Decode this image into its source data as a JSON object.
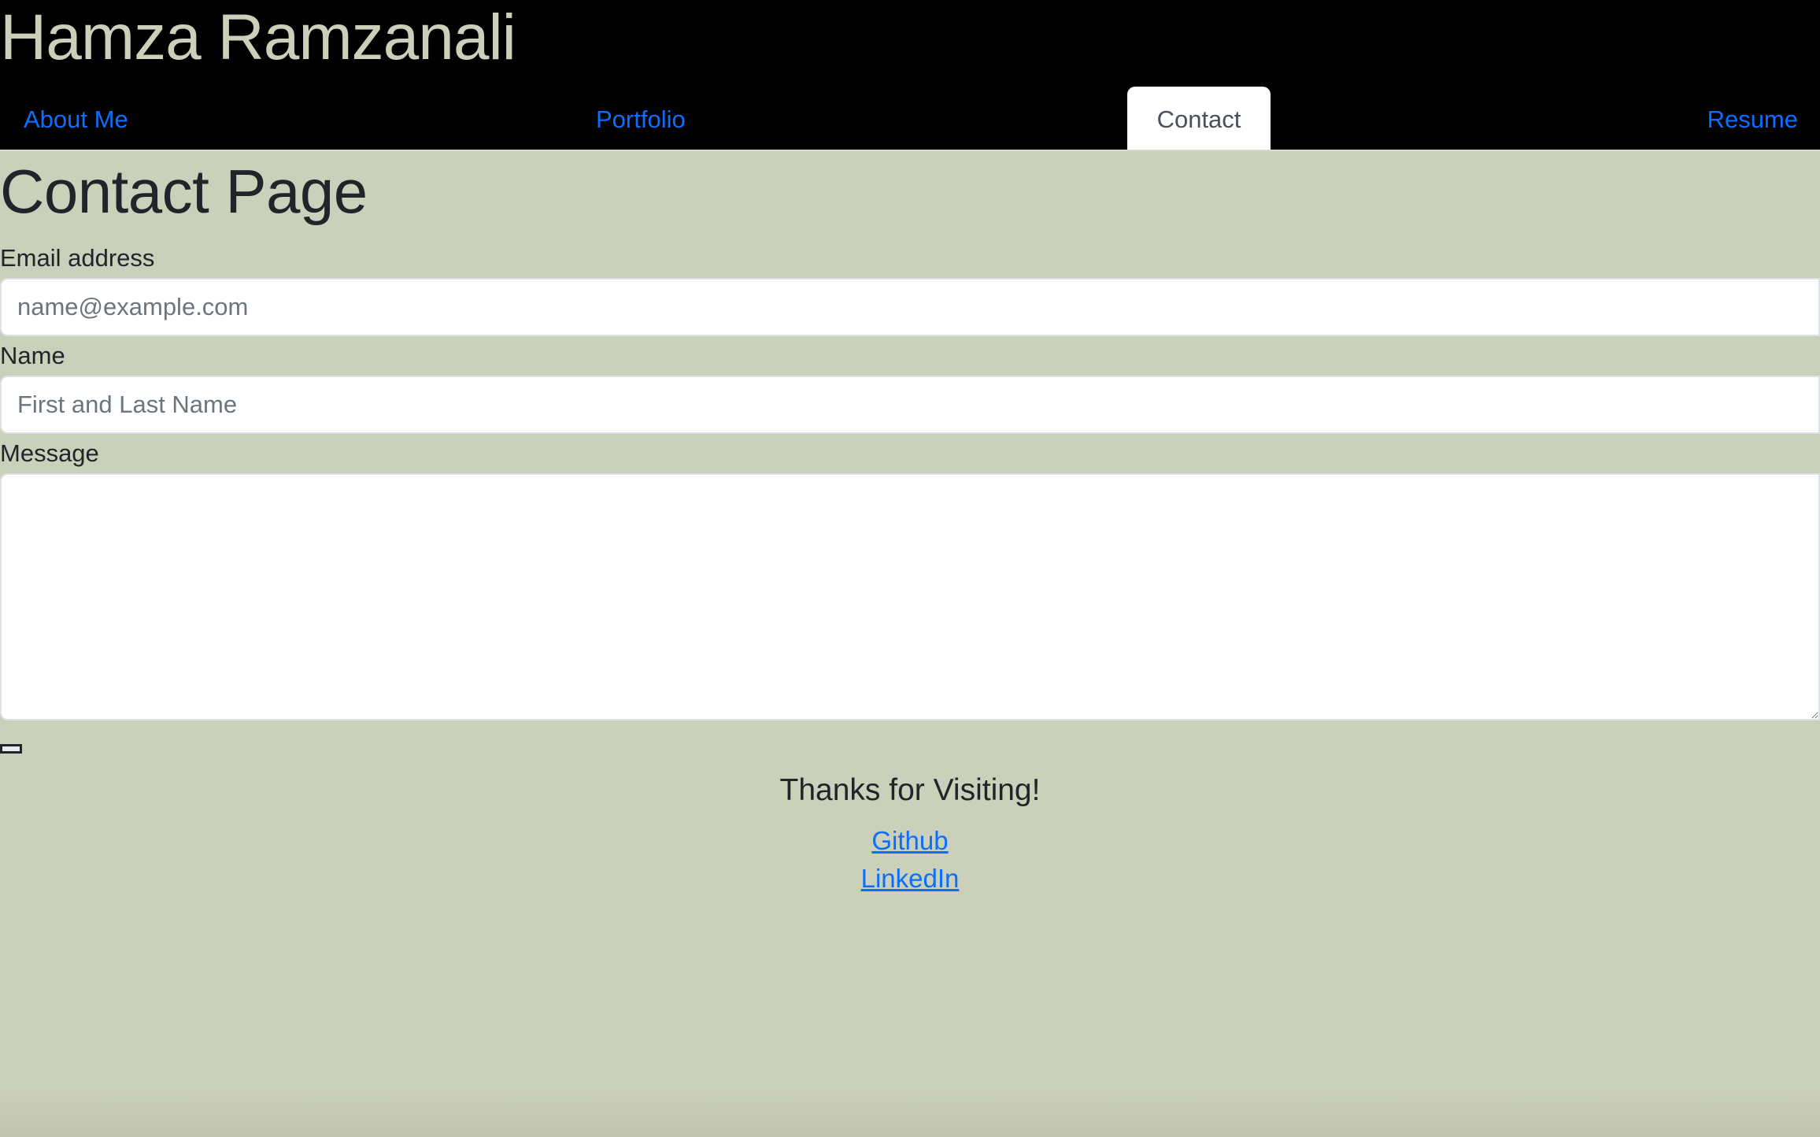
{
  "header": {
    "site_title": "Hamza Ramzanali",
    "nav": {
      "about": "About Me",
      "portfolio": "Portfolio",
      "contact": "Contact",
      "resume": "Resume"
    },
    "active_tab": "Contact"
  },
  "main": {
    "page_title": "Contact Page",
    "email": {
      "label": "Email address",
      "placeholder": "name@example.com",
      "value": ""
    },
    "name": {
      "label": "Name",
      "placeholder": "First and Last Name",
      "value": ""
    },
    "message": {
      "label": "Message",
      "value": ""
    }
  },
  "footer": {
    "title": "Thanks for Visiting!",
    "links": {
      "github": "Github",
      "linkedin": "LinkedIn"
    }
  },
  "colors": {
    "header_background": "#000000",
    "page_background": "#cbd0bb",
    "site_title": "#cbd0bb",
    "link": "#0d6efd",
    "active_tab_background": "#ffffff",
    "text": "#212529"
  }
}
